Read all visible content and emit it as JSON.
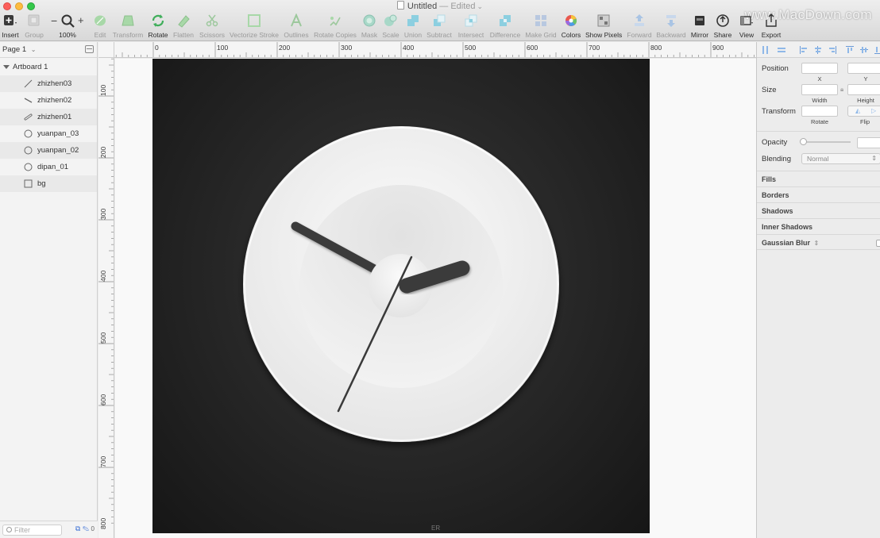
{
  "window": {
    "title": "Untitled",
    "status": "— Edited"
  },
  "toolbar": {
    "insert": "Insert",
    "group": "Group",
    "zoom": "100%",
    "zoom_minus": "−",
    "zoom_plus": "+",
    "edit": "Edit",
    "transform": "Transform",
    "rotate": "Rotate",
    "flatten": "Flatten",
    "scissors": "Scissors",
    "vectorize": "Vectorize Stroke",
    "outlines": "Outlines",
    "rotate_copies": "Rotate Copies",
    "mask": "Mask",
    "scale": "Scale",
    "union": "Union",
    "subtract": "Subtract",
    "intersect": "Intersect",
    "difference": "Difference",
    "make_grid": "Make Grid",
    "colors": "Colors",
    "show_pixels": "Show Pixels",
    "forward": "Forward",
    "backward": "Backward",
    "mirror": "Mirror",
    "share": "Share",
    "view": "View",
    "export": "Export"
  },
  "watermark": "www.MacDown.com",
  "layers": {
    "page": "Page 1",
    "artboard": "Artboard 1",
    "items": [
      {
        "name": "zhizhen03",
        "icon": "line-icon"
      },
      {
        "name": "zhizhen02",
        "icon": "line-icon"
      },
      {
        "name": "zhizhen01",
        "icon": "capsule-icon"
      },
      {
        "name": "yuanpan_03",
        "icon": "oval-icon"
      },
      {
        "name": "yuanpan_02",
        "icon": "oval-icon"
      },
      {
        "name": "dipan_01",
        "icon": "oval-icon"
      },
      {
        "name": "bg",
        "icon": "rectangle-icon"
      }
    ],
    "filter_placeholder": "Filter",
    "footer_count": "0"
  },
  "rulers": {
    "horizontal": [
      "0",
      "100",
      "200",
      "300",
      "400",
      "500",
      "600",
      "700",
      "800",
      "900"
    ],
    "vertical": [
      "100",
      "200",
      "300",
      "400",
      "500",
      "600",
      "700",
      "800"
    ]
  },
  "artboard_watermark": "ER",
  "inspector": {
    "position": "Position",
    "x": "X",
    "y": "Y",
    "size": "Size",
    "width": "Width",
    "height": "Height",
    "transform": "Transform",
    "rotate": "Rotate",
    "flip": "Flip",
    "opacity": "Opacity",
    "blending": "Blending",
    "blend_mode": "Normal",
    "sections": [
      "Fills",
      "Borders",
      "Shadows",
      "Inner Shadows",
      "Gaussian Blur"
    ]
  },
  "colors": {
    "accent": "#3a6fd6",
    "clock_face": "#f2f2f2",
    "hand": "#3a3a3a",
    "background_dark": "#1c1c1c"
  }
}
